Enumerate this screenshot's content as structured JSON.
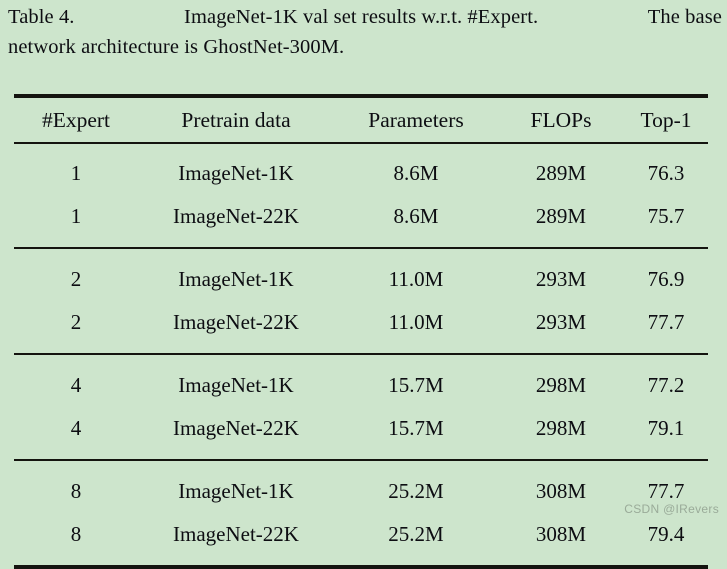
{
  "caption": {
    "lines": [
      [
        "Table 4.",
        "ImageNet-1K val set results w.r.t. #Expert.",
        "The base"
      ],
      [
        "network architecture is GhostNet-300M."
      ]
    ],
    "line1_part1": "Table 4.",
    "line1_part2": "ImageNet-1K val set results w.r.t. #Expert.",
    "line1_part3": "The base",
    "line2": "network architecture is GhostNet-300M."
  },
  "table": {
    "headers": {
      "expert": "#Expert",
      "pretrain": "Pretrain data",
      "parameters": "Parameters",
      "flops": "FLOPs",
      "top1": "Top-1"
    },
    "groups": [
      {
        "rows": [
          {
            "expert": "1",
            "pretrain": "ImageNet-1K",
            "parameters": "8.6M",
            "flops": "289M",
            "top1": "76.3"
          },
          {
            "expert": "1",
            "pretrain": "ImageNet-22K",
            "parameters": "8.6M",
            "flops": "289M",
            "top1": "75.7"
          }
        ]
      },
      {
        "rows": [
          {
            "expert": "2",
            "pretrain": "ImageNet-1K",
            "parameters": "11.0M",
            "flops": "293M",
            "top1": "76.9"
          },
          {
            "expert": "2",
            "pretrain": "ImageNet-22K",
            "parameters": "11.0M",
            "flops": "293M",
            "top1": "77.7"
          }
        ]
      },
      {
        "rows": [
          {
            "expert": "4",
            "pretrain": "ImageNet-1K",
            "parameters": "15.7M",
            "flops": "298M",
            "top1": "77.2"
          },
          {
            "expert": "4",
            "pretrain": "ImageNet-22K",
            "parameters": "15.7M",
            "flops": "298M",
            "top1": "79.1"
          }
        ]
      },
      {
        "rows": [
          {
            "expert": "8",
            "pretrain": "ImageNet-1K",
            "parameters": "25.2M",
            "flops": "308M",
            "top1": "77.7"
          },
          {
            "expert": "8",
            "pretrain": "ImageNet-22K",
            "parameters": "25.2M",
            "flops": "308M",
            "top1": "79.4"
          }
        ]
      }
    ]
  },
  "watermark": {
    "text": "CSDN @IRevers"
  },
  "colors": {
    "background": "#cde5cc",
    "text": "#0d0d12",
    "rule": "#14140f",
    "watermark": "#9aab99"
  }
}
